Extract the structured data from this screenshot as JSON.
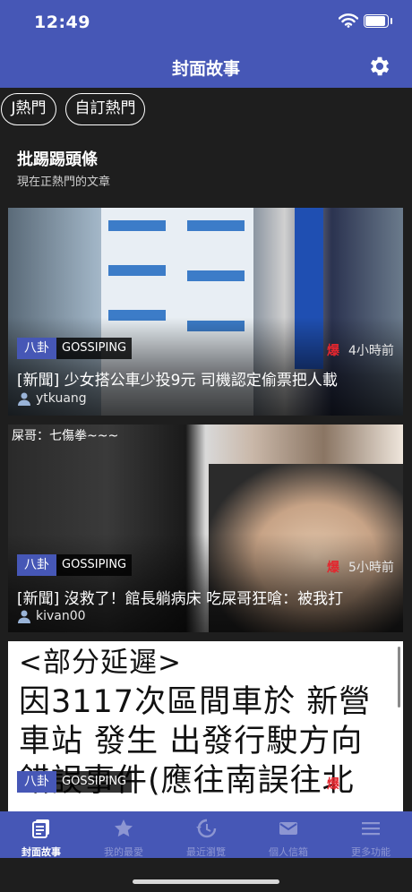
{
  "status_bar": {
    "time": "12:49"
  },
  "nav": {
    "title": "封面故事"
  },
  "tabs": [
    "J熱門",
    "自訂熱門"
  ],
  "section": {
    "title": "批踢踢頭條",
    "subtitle": "現在正熱門的文章"
  },
  "articles": [
    {
      "category": "八卦",
      "board": "GOSSIPING",
      "hot": "爆",
      "time_ago": "4小時前",
      "title": "[新聞] 少女搭公車少投9元 司機認定偷票把人載",
      "author": "ytkuang"
    },
    {
      "category": "八卦",
      "board": "GOSSIPING",
      "hot": "爆",
      "time_ago": "5小時前",
      "title": "[新聞] 沒救了！館長躺病床 吃屎哥狂嗆：被我打",
      "author": "kivan00",
      "image_caption": "屎哥：七傷拳~~~"
    },
    {
      "category": "八卦",
      "board": "GOSSIPING",
      "hot": "爆",
      "image_text": [
        "<部分延遲>",
        "因3117次區間車於 新營",
        "車站 發生 出發行駛方向",
        "錯誤事件(應往南誤往北"
      ]
    }
  ],
  "tabbar": [
    {
      "label": "封面故事",
      "icon": "cover-story-icon",
      "active": true
    },
    {
      "label": "我的最愛",
      "icon": "star-icon",
      "active": false
    },
    {
      "label": "最近瀏覽",
      "icon": "history-icon",
      "active": false
    },
    {
      "label": "個人信箱",
      "icon": "mail-icon",
      "active": false
    },
    {
      "label": "更多功能",
      "icon": "menu-icon",
      "active": false
    }
  ],
  "colors": {
    "primary": "#4657b6",
    "background": "#1e1e1e",
    "hot": "#e3262e",
    "inactive_tab": "#8d96d2"
  }
}
